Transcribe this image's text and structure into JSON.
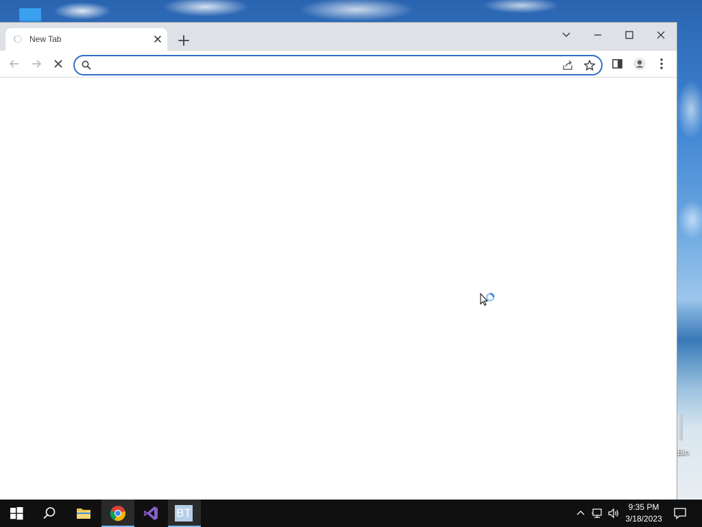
{
  "browser": {
    "tab": {
      "title": "New Tab"
    },
    "omnibox": {
      "value": "",
      "placeholder": ""
    }
  },
  "desktop": {
    "recycle_bin_label": "Bin"
  },
  "taskbar": {
    "apps": [
      "start",
      "search",
      "file-explorer",
      "chrome",
      "visual-studio",
      "bt-app"
    ],
    "active_app": "chrome",
    "bt_label": "BT",
    "clock": {
      "time": "9:35 PM",
      "date": "3/18/2023"
    }
  },
  "colors": {
    "accent": "#2f6cc6",
    "tabstrip": "#dee1e6",
    "taskbar": "#101010"
  }
}
